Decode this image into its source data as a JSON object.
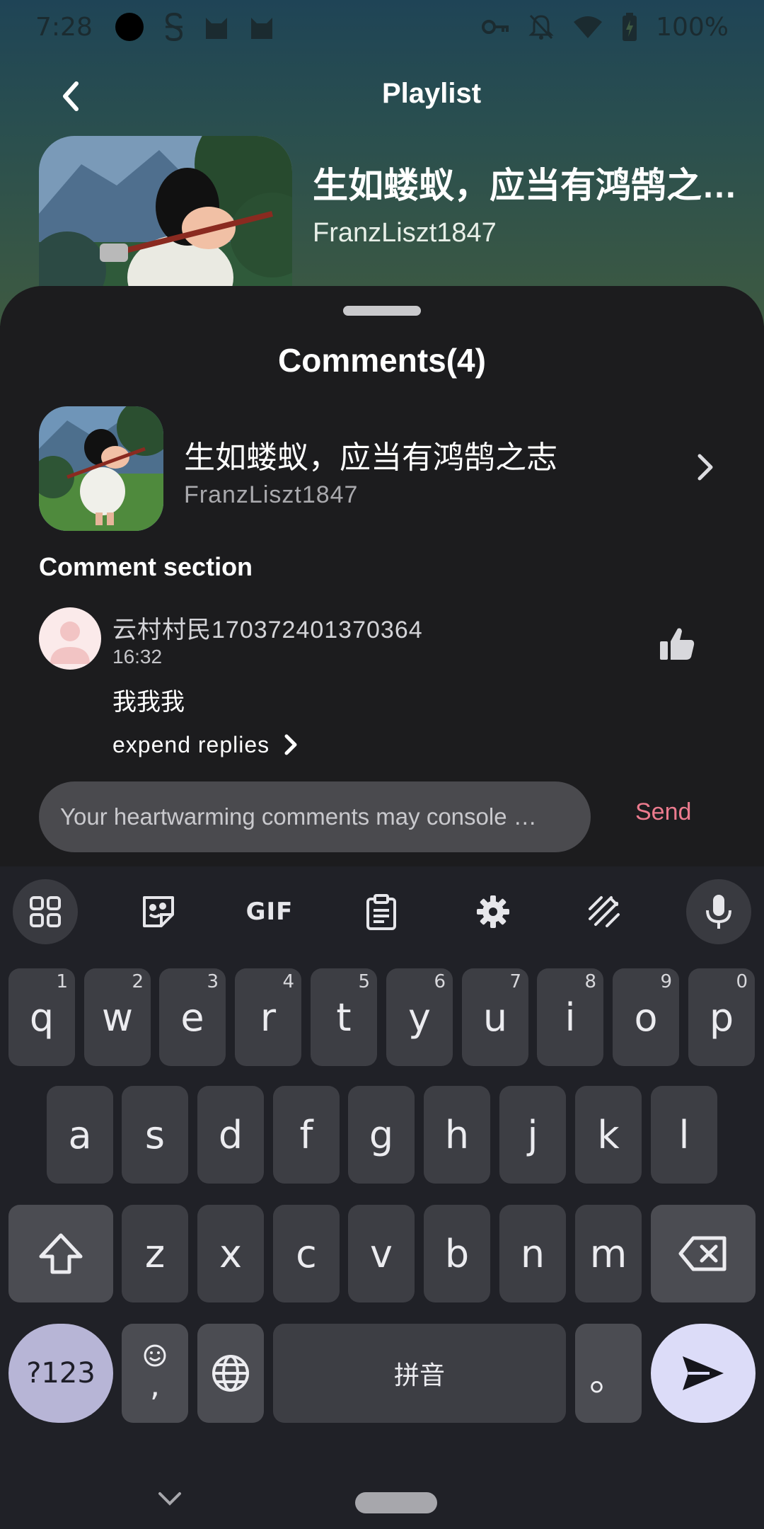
{
  "status_bar": {
    "time": "7:28",
    "battery": "100%",
    "icons": [
      "record-dot-icon",
      "s-icon",
      "cat-icon",
      "cat-icon",
      "key-icon",
      "bell-off-icon",
      "wifi-icon",
      "battery-icon"
    ]
  },
  "header": {
    "title": "Playlist"
  },
  "playlist": {
    "title": "生如蝼蚁，应当有鸿鹄之…",
    "author": "FranzLiszt1847"
  },
  "comments_sheet": {
    "title": "Comments(4)",
    "playlist_row": {
      "title": "生如蝼蚁，应当有鸿鹄之志",
      "author": "FranzLiszt1847"
    },
    "section_label": "Comment section",
    "comments": [
      {
        "user": "云村村民170372401370364",
        "time": "16:32",
        "text": "我我我",
        "expand_label": "expend replies"
      }
    ],
    "input": {
      "placeholder": "Your heartwarming comments may console …",
      "value": ""
    },
    "send_label": "Send"
  },
  "keyboard": {
    "toolbar": [
      "apps-grid-icon",
      "sticker-icon",
      "GIF",
      "clipboard-icon",
      "gear-icon",
      "handwriting-icon",
      "mic-icon"
    ],
    "row1": [
      {
        "key": "q",
        "hint": "1"
      },
      {
        "key": "w",
        "hint": "2"
      },
      {
        "key": "e",
        "hint": "3"
      },
      {
        "key": "r",
        "hint": "4"
      },
      {
        "key": "t",
        "hint": "5"
      },
      {
        "key": "y",
        "hint": "6"
      },
      {
        "key": "u",
        "hint": "7"
      },
      {
        "key": "i",
        "hint": "8"
      },
      {
        "key": "o",
        "hint": "9"
      },
      {
        "key": "p",
        "hint": "0"
      }
    ],
    "row2": [
      "a",
      "s",
      "d",
      "f",
      "g",
      "h",
      "j",
      "k",
      "l"
    ],
    "row3": [
      "z",
      "x",
      "c",
      "v",
      "b",
      "n",
      "m"
    ],
    "sym_label": "?123",
    "comma_label": ",",
    "space_label": "拼音",
    "period_label": "。"
  },
  "colors": {
    "accent_send": "#ec7b8e",
    "sheet_bg": "#1c1c1e",
    "keyboard_bg": "#202127"
  }
}
